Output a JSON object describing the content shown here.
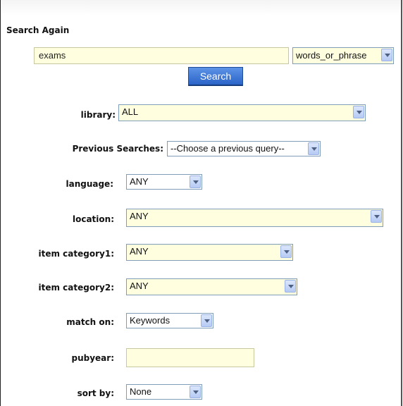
{
  "search_again": {
    "heading": "Search Again",
    "query_value": "exams",
    "mode_value": "words_or_phrase",
    "search_button": "Search"
  },
  "filters": {
    "library": {
      "label": "library:",
      "value": "ALL"
    },
    "previous": {
      "label": "Previous Searches:",
      "value": "--Choose a previous query--"
    },
    "language": {
      "label": "language:",
      "value": "ANY"
    },
    "location": {
      "label": "location:",
      "value": "ANY"
    },
    "item_category1": {
      "label": "item category1:",
      "value": "ANY"
    },
    "item_category2": {
      "label": "item category2:",
      "value": "ANY"
    },
    "match_on": {
      "label": "match on:",
      "value": "Keywords"
    },
    "pubyear": {
      "label": "pubyear:",
      "value": ""
    },
    "sort_by": {
      "label": "sort by:",
      "value": "None"
    }
  }
}
